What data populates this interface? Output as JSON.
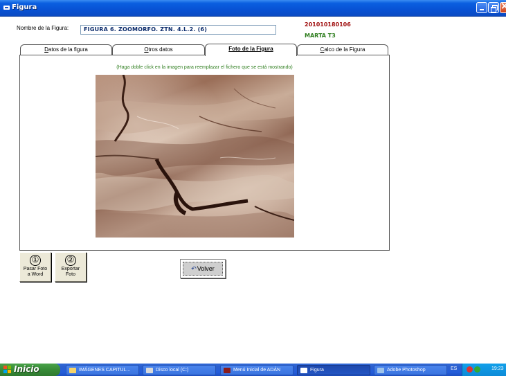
{
  "window": {
    "title": "Figura"
  },
  "header": {
    "name_label": "Nombre de la Figura:",
    "name_value": "FIGURA 6. ZOOMORFO. ZTN. 4.L.2. (6)",
    "record_id": "201010180106",
    "author": "MARTA T3"
  },
  "tabs": [
    {
      "label_ul": "D",
      "label_rest": "atos de la figura",
      "active": false
    },
    {
      "label_ul": "O",
      "label_rest": "tros datos",
      "active": false
    },
    {
      "label": "Foto de la Figura",
      "active": true
    },
    {
      "label_ul": "C",
      "label_rest": "alco de la Figura",
      "active": false
    }
  ],
  "panel": {
    "hint": "(Haga doble click en la imagen para reemplazar el fichero que se está mostrando)"
  },
  "actions": {
    "pasar": {
      "number": "①",
      "line1": "Pasar Foto",
      "line2": "a Word"
    },
    "exportar": {
      "number": "②",
      "line1": "Exportar",
      "line2": "Foto"
    },
    "volver": {
      "label": "Volver"
    }
  },
  "taskbar": {
    "start": "Inicio",
    "tasks": [
      {
        "label": "IMÁGENES CAPITUL...",
        "icon": "folder-icon",
        "color": "#f5d36b",
        "active": false
      },
      {
        "label": "Disco local (C:)",
        "icon": "drive-icon",
        "color": "#d9d9d9",
        "active": false
      },
      {
        "label": "Menú Inicial de ADÁN",
        "icon": "app-icon",
        "color": "#8a1c1c",
        "active": false
      },
      {
        "label": "Figura",
        "icon": "form-icon",
        "color": "#ffffff",
        "active": true
      },
      {
        "label": "Adobe Photoshop",
        "icon": "photoshop-icon",
        "color": "#9ec3ea",
        "active": false
      }
    ],
    "language": "ES",
    "clock": "19:23"
  }
}
